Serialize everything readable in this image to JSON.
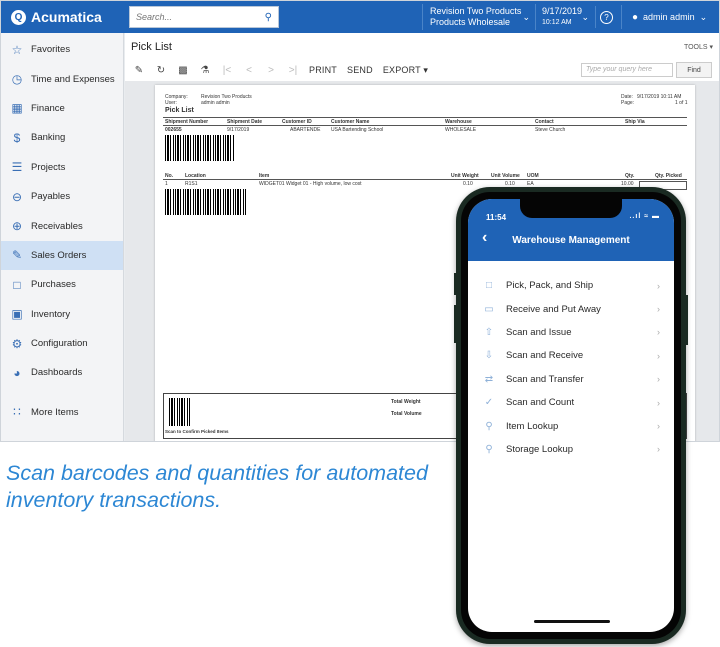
{
  "app": {
    "name": "Acumatica",
    "brand_color": "#1f63b6"
  },
  "topbar": {
    "search_placeholder": "Search...",
    "branch_line1": "Revision Two Products",
    "branch_line2": "Products Wholesale",
    "date": "9/17/2019",
    "time": "10:12 AM",
    "help_icon": "question-circle-icon",
    "user": "admin admin"
  },
  "sidebar": {
    "items": [
      {
        "label": "Favorites",
        "icon": "star-icon"
      },
      {
        "label": "Time and Expenses",
        "icon": "clock-icon"
      },
      {
        "label": "Finance",
        "icon": "calculator-icon"
      },
      {
        "label": "Banking",
        "icon": "dollar-icon"
      },
      {
        "label": "Projects",
        "icon": "gantt-icon"
      },
      {
        "label": "Payables",
        "icon": "minus-circle-icon"
      },
      {
        "label": "Receivables",
        "icon": "plus-circle-icon"
      },
      {
        "label": "Sales Orders",
        "icon": "edit-icon"
      },
      {
        "label": "Purchases",
        "icon": "cart-icon"
      },
      {
        "label": "Inventory",
        "icon": "truck-icon"
      },
      {
        "label": "Configuration",
        "icon": "gear-icon"
      },
      {
        "label": "Dashboards",
        "icon": "dashboard-icon"
      },
      {
        "label": "More Items",
        "icon": "grid-icon"
      }
    ],
    "active_index": 7
  },
  "main": {
    "title": "Pick List",
    "tools": "TOOLS ▾",
    "toolbar": {
      "print": "PRINT",
      "send": "SEND",
      "export": "EXPORT ▾"
    },
    "query_placeholder": "Type your query here",
    "find": "Find"
  },
  "report": {
    "company_label": "Company:",
    "company_value": "Revision Two Products",
    "user_label": "User:",
    "user_value": "admin admin",
    "date_label": "Date:",
    "date_value": "9/17/2019 10:11 AM",
    "page_label": "Page:",
    "page_value": "1 of 1",
    "title": "Pick List",
    "headers": [
      "Shipment Number",
      "Shipment Date",
      "Customer ID",
      "Customer Name",
      "Warehouse",
      "Contact",
      "Ship Via"
    ],
    "row": [
      "002655",
      "9/17/2019",
      "ABARTENDE",
      "USA Bartending School",
      "WHOLESALE",
      "Steve Church",
      ""
    ],
    "line_headers": [
      "No.",
      "Location",
      "Item",
      "Unit Weight",
      "Unit Volume",
      "UOM",
      "Qty.",
      "Qty. Picked"
    ],
    "line_row": [
      "1",
      "R1S1",
      "WIDGET01  Widget 01 - High volume, low cost",
      "0.10",
      "0.10",
      "EA",
      "10.00",
      ""
    ],
    "total_weight": "Total Weight",
    "total_volume": "Total Volume",
    "scan_confirm": "Scan to Confirm Picked Items"
  },
  "caption": "Scan barcodes and quantities for automated inventory transactions.",
  "phone": {
    "time": "11:54",
    "status": "..ıl ≈ ▬",
    "title": "Warehouse Management",
    "menu": [
      {
        "label": "Pick, Pack, and Ship",
        "icon": "box-icon"
      },
      {
        "label": "Receive and Put Away",
        "icon": "inbox-icon"
      },
      {
        "label": "Scan and Issue",
        "icon": "arrow-up-box-icon"
      },
      {
        "label": "Scan and Receive",
        "icon": "arrow-down-box-icon"
      },
      {
        "label": "Scan and Transfer",
        "icon": "transfer-icon"
      },
      {
        "label": "Scan and Count",
        "icon": "check-circle-icon"
      },
      {
        "label": "Item Lookup",
        "icon": "search-icon"
      },
      {
        "label": "Storage Lookup",
        "icon": "search-icon"
      }
    ]
  }
}
